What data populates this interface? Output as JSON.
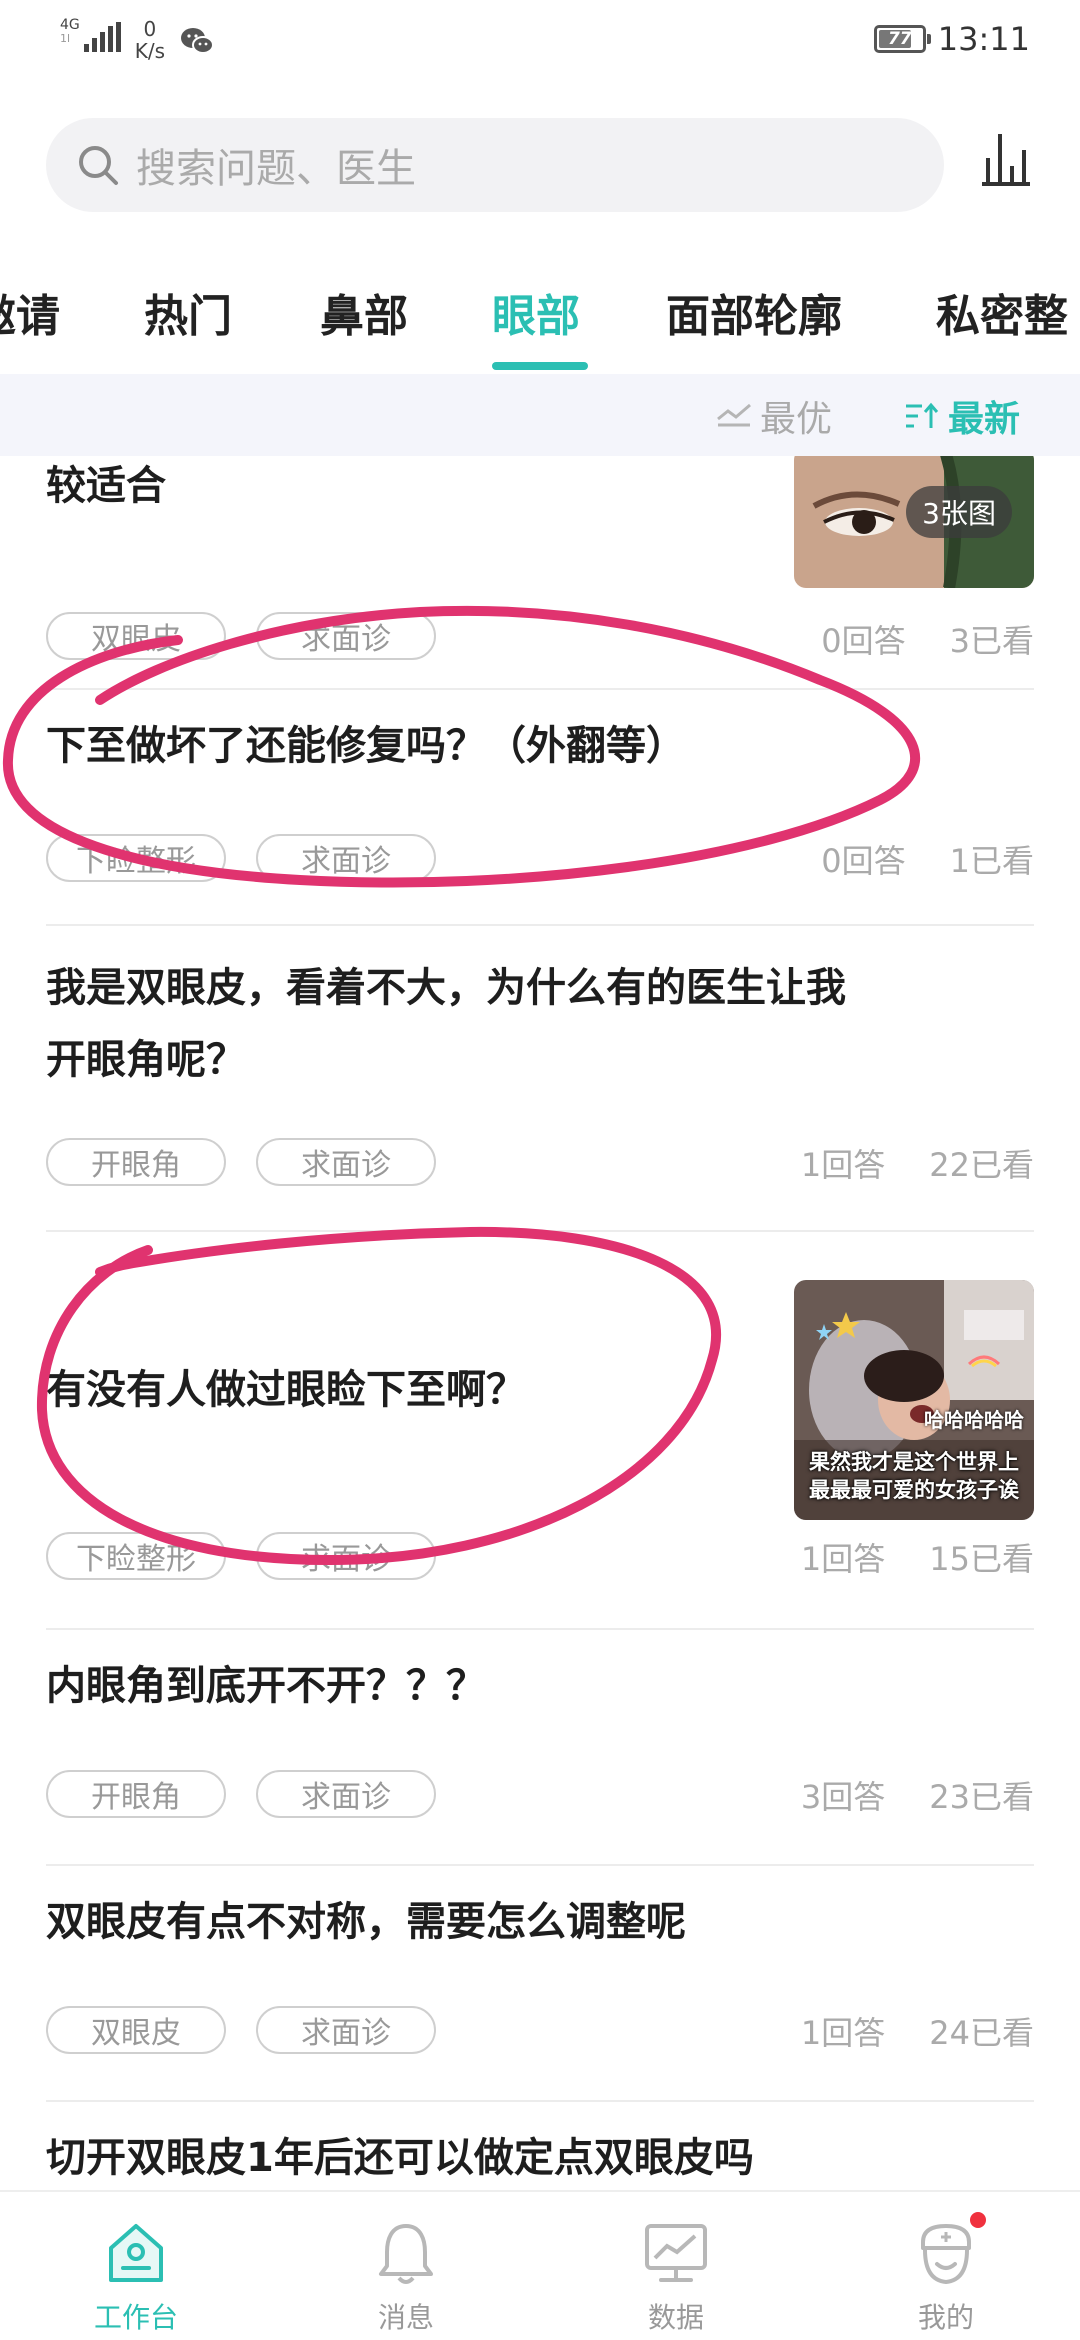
{
  "status_bar": {
    "signal_label": "4G",
    "signal_sub": "1l",
    "speed_value": "0",
    "speed_unit": "K/s",
    "battery_level": "77",
    "time": "13:11",
    "icons": [
      "signal-icon",
      "wechat-icon",
      "battery-icon"
    ]
  },
  "search": {
    "placeholder": "搜索问题、医生",
    "icon": "search-icon",
    "stats_icon": "bar-chart-icon"
  },
  "tabs": [
    {
      "label": "邀请",
      "active": false
    },
    {
      "label": "热门",
      "active": false
    },
    {
      "label": "鼻部",
      "active": false
    },
    {
      "label": "眼部",
      "active": true
    },
    {
      "label": "面部轮廓",
      "active": false
    },
    {
      "label": "私密整",
      "active": false
    }
  ],
  "sort": {
    "best_label": "最优",
    "newest_label": "最新",
    "active": "newest"
  },
  "feed": [
    {
      "title_lines": [
        "较适合"
      ],
      "tags": [
        "双眼皮",
        "求面诊"
      ],
      "answers": "0回答",
      "views": "3已看",
      "thumb_badge": "3张图"
    },
    {
      "title_lines": [
        "下至做坏了还能修复吗？（外翻等）"
      ],
      "tags": [
        "下睑整形",
        "求面诊"
      ],
      "answers": "0回答",
      "views": "1已看"
    },
    {
      "title_lines": [
        "我是双眼皮，看着不大，为什么有的医生让我",
        "开眼角呢？"
      ],
      "tags": [
        "开眼角",
        "求面诊"
      ],
      "answers": "1回答",
      "views": "22已看"
    },
    {
      "title_lines": [
        "有没有人做过眼睑下至啊？"
      ],
      "tags": [
        "下睑整形",
        "求面诊"
      ],
      "answers": "1回答",
      "views": "15已看",
      "thumb_caption_top": "哈哈哈哈哈",
      "thumb_caption": "果然我才是这个世界上最最最可爱的女孩子诶"
    },
    {
      "title_lines": [
        "内眼角到底开不开？？？"
      ],
      "tags": [
        "开眼角",
        "求面诊"
      ],
      "answers": "3回答",
      "views": "23已看"
    },
    {
      "title_lines": [
        "双眼皮有点不对称，需要怎么调整呢"
      ],
      "tags": [
        "双眼皮",
        "求面诊"
      ],
      "answers": "1回答",
      "views": "24已看"
    },
    {
      "title_lines": [
        "切开双眼皮1年后还可以做定点双眼皮吗"
      ]
    }
  ],
  "bottom_nav": [
    {
      "label": "工作台",
      "icon": "home-icon",
      "active": true
    },
    {
      "label": "消息",
      "icon": "bell-icon",
      "active": false
    },
    {
      "label": "数据",
      "icon": "chart-monitor-icon",
      "active": false
    },
    {
      "label": "我的",
      "icon": "doctor-avatar-icon",
      "active": false,
      "badge": true
    }
  ],
  "colors": {
    "accent": "#2bbfb3",
    "annotation": "#e0336f",
    "badge": "#f0313e"
  }
}
